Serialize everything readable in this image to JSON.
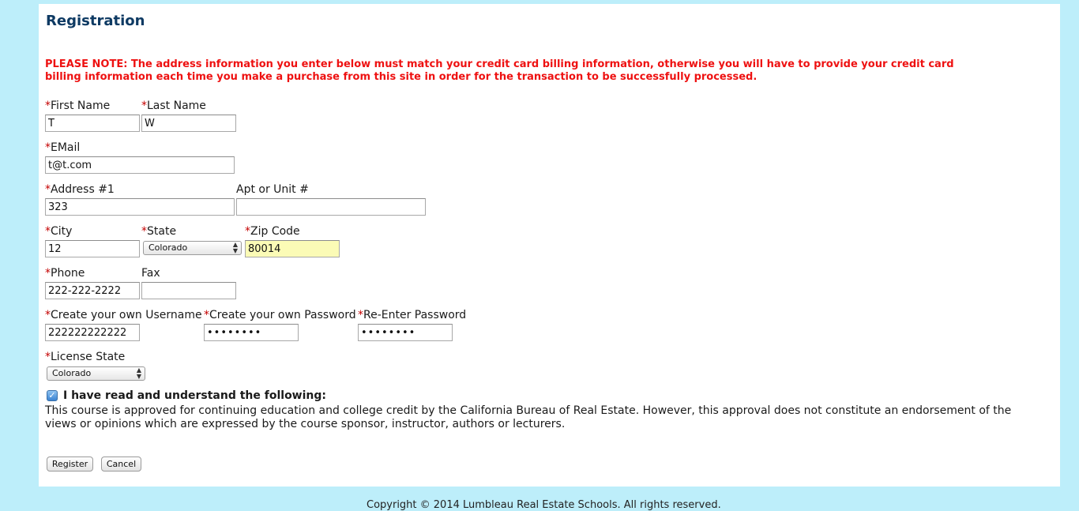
{
  "page": {
    "title": "Registration",
    "notice": "PLEASE NOTE: The address information you enter below must match your credit card billing information, otherwise you will have to provide your credit card billing information each time you make a purchase from this site in order for the transaction to be successfully processed.",
    "required_marker": "*"
  },
  "form": {
    "first_name": {
      "label": "First Name",
      "value": "T"
    },
    "last_name": {
      "label": "Last Name",
      "value": "W"
    },
    "email": {
      "label": "EMail",
      "value": "t@t.com"
    },
    "address1": {
      "label": "Address #1",
      "value": "323"
    },
    "apt": {
      "label": "Apt or Unit #",
      "value": ""
    },
    "city": {
      "label": "City",
      "value": "12"
    },
    "state": {
      "label": "State",
      "selected": "Colorado"
    },
    "zip": {
      "label": "Zip Code",
      "value": "80014"
    },
    "phone": {
      "label": "Phone",
      "value": "222-222-2222"
    },
    "fax": {
      "label": "Fax",
      "value": ""
    },
    "username": {
      "label": "Create your own Username",
      "value": "222222222222"
    },
    "password": {
      "label": "Create your own Password",
      "value": "••••••••"
    },
    "password_confirm": {
      "label": "Re-Enter Password",
      "value": "••••••••"
    },
    "license_state": {
      "label": "License State",
      "selected": "Colorado"
    }
  },
  "agreement": {
    "checked": true,
    "label": "I have read and understand the following:",
    "text": "This course is approved for continuing education and college credit by the California Bureau of Real Estate. However, this approval does not constitute an endorsement of the views or opinions which are expressed by the course sponsor, instructor, authors or lecturers."
  },
  "buttons": {
    "register": "Register",
    "cancel": "Cancel"
  },
  "footer": {
    "copyright": "Copyright © 2014 Lumbleau Real Estate Schools. All rights reserved."
  },
  "icons": {
    "select_arrows": "updown-arrows-icon",
    "checkbox": "checkmark-icon"
  },
  "colors": {
    "background": "#bdeefa",
    "title": "#0e3a63",
    "notice": "#ee1111",
    "required": "#c40000",
    "highlight_field": "#fbfbb6"
  }
}
